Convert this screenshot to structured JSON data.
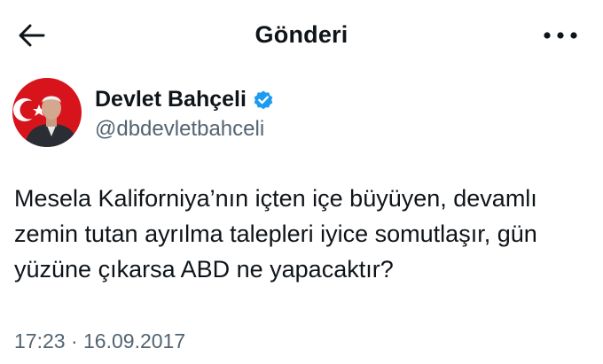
{
  "header": {
    "title": "Gönderi",
    "back_icon": "arrow-left-icon",
    "more_icon": "more-horizontal-icon"
  },
  "author": {
    "display_name": "Devlet Bahçeli",
    "handle": "@dbdevletbahceli",
    "verified": true,
    "verified_color": "#1d9bf0"
  },
  "post": {
    "text": "Mesela Kaliforniya’nın içten içe büyüyen, devamlı zemin tutan ayrılma talepleri iyice somutlaşır, gün yüzüne çıkarsa ABD ne yapacaktır?",
    "time": "17:23",
    "separator": "·",
    "date": "16.09.2017"
  }
}
